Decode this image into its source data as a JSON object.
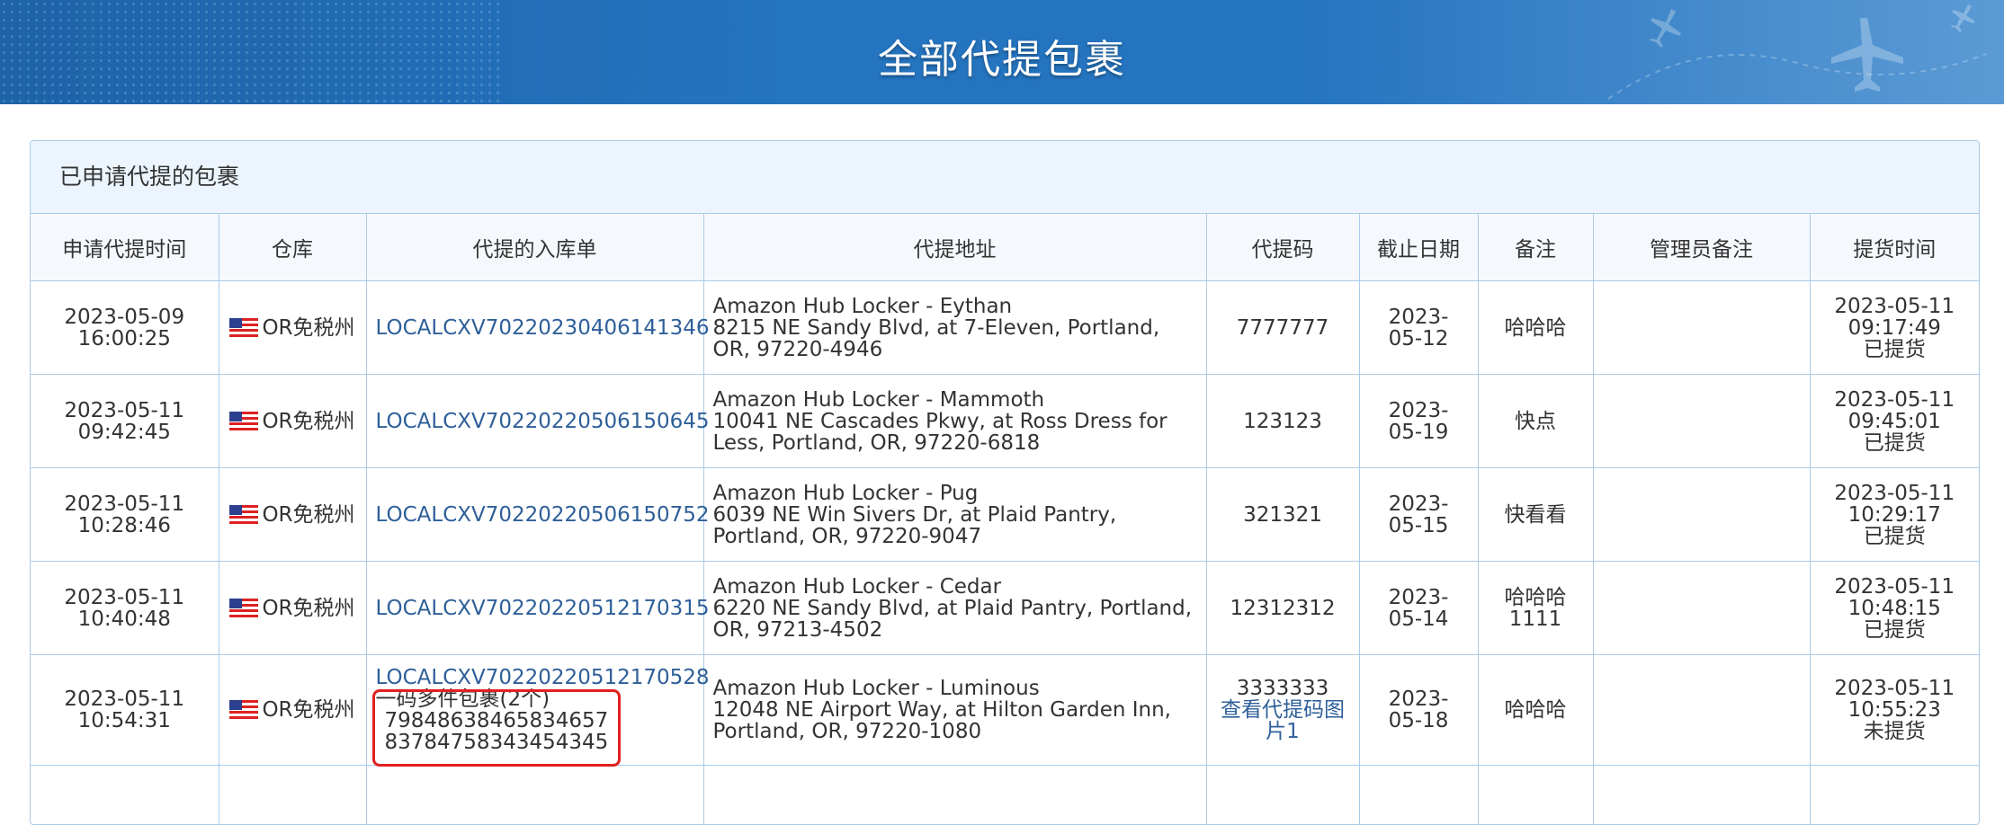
{
  "page_title": "全部代提包裹",
  "panel_title": "已申请代提的包裹",
  "columns": [
    "申请代提时间",
    "仓库",
    "代提的入库单",
    "代提地址",
    "代提码",
    "截止日期",
    "备注",
    "管理员备注",
    "提货时间"
  ],
  "rows": [
    {
      "apply_date": "2023-05-09",
      "apply_time": "16:00:25",
      "warehouse": "OR免税州",
      "order": "LOCALCXV70220230406141346",
      "addr_name": "Amazon Hub Locker - Eythan",
      "addr_line": "8215 NE Sandy Blvd, at 7-Eleven, Portland, OR, 97220-4946",
      "code": "7777777",
      "code_link": "",
      "deadline": "2023-05-12",
      "remark": "哈哈哈",
      "admin_remark": "",
      "pickup_date": "2023-05-11",
      "pickup_time": "09:17:49",
      "pickup_status": "已提货"
    },
    {
      "apply_date": "2023-05-11",
      "apply_time": "09:42:45",
      "warehouse": "OR免税州",
      "order": "LOCALCXV70220220506150645",
      "addr_name": "Amazon Hub Locker - Mammoth",
      "addr_line": "10041 NE Cascades Pkwy, at Ross Dress for Less, Portland, OR, 97220-6818",
      "code": "123123",
      "code_link": "",
      "deadline": "2023-05-19",
      "remark": "快点",
      "admin_remark": "",
      "pickup_date": "2023-05-11",
      "pickup_time": "09:45:01",
      "pickup_status": "已提货"
    },
    {
      "apply_date": "2023-05-11",
      "apply_time": "10:28:46",
      "warehouse": "OR免税州",
      "order": "LOCALCXV70220220506150752",
      "addr_name": "Amazon Hub Locker - Pug",
      "addr_line": "6039 NE Win Sivers Dr, at Plaid Pantry, Portland, OR, 97220-9047",
      "code": "321321",
      "code_link": "",
      "deadline": "2023-05-15",
      "remark": "快看看",
      "admin_remark": "",
      "pickup_date": "2023-05-11",
      "pickup_time": "10:29:17",
      "pickup_status": "已提货"
    },
    {
      "apply_date": "2023-05-11",
      "apply_time": "10:40:48",
      "warehouse": "OR免税州",
      "order": "LOCALCXV70220220512170315",
      "addr_name": "Amazon Hub Locker - Cedar",
      "addr_line": "6220 NE Sandy Blvd, at Plaid Pantry, Portland, OR, 97213-4502",
      "code": "12312312",
      "code_link": "",
      "deadline": "2023-05-14",
      "remark": "哈哈哈 1111",
      "admin_remark": "",
      "pickup_date": "2023-05-11",
      "pickup_time": "10:48:15",
      "pickup_status": "已提货"
    },
    {
      "apply_date": "2023-05-11",
      "apply_time": "10:54:31",
      "warehouse": "OR免税州",
      "order": "LOCALCXV70220220512170528",
      "multi_title": "一码多件包裹(2个)",
      "multi_items": [
        "79848638465834657",
        "83784758343454345"
      ],
      "addr_name": "Amazon Hub Locker - Luminous",
      "addr_line": "12048 NE Airport Way, at Hilton Garden Inn, Portland, OR, 97220-1080",
      "code": "3333333",
      "code_link": "查看代提码图片1",
      "deadline": "2023-05-18",
      "remark": "哈哈哈",
      "admin_remark": "",
      "pickup_date": "2023-05-11",
      "pickup_time": "10:55:23",
      "pickup_status": "未提货"
    }
  ]
}
